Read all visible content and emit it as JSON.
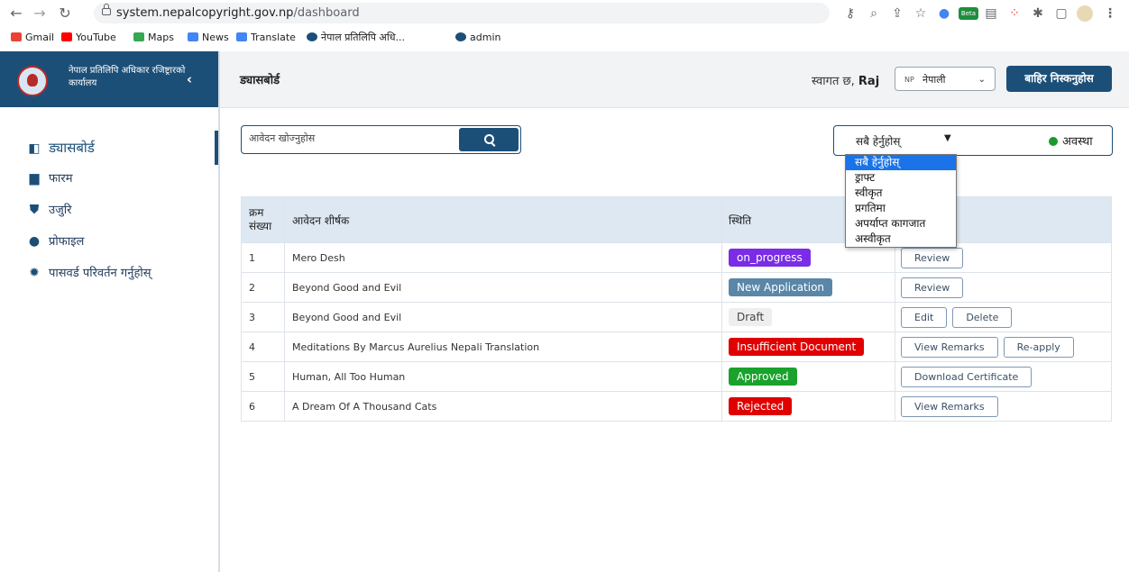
{
  "browser": {
    "url_host": "system.nepalcopyright.gov.np",
    "url_path": "/dashboard",
    "beta_badge": "Beta",
    "bookmarks": [
      {
        "label": "Gmail",
        "icon": "gmail-icon",
        "color": "#ea4335"
      },
      {
        "label": "YouTube",
        "icon": "youtube-icon",
        "color": "#ff0000"
      },
      {
        "label": "Maps",
        "icon": "maps-icon",
        "color": "#34a853"
      },
      {
        "label": "News",
        "icon": "news-icon",
        "color": "#4285f4"
      },
      {
        "label": "Translate",
        "icon": "translate-icon",
        "color": "#4285f4"
      },
      {
        "label": "नेपाल प्रतिलिपि अधि...",
        "icon": "nepal-emblem-icon",
        "color": "#1c4f78"
      },
      {
        "label": "admin",
        "icon": "nepal-emblem-icon",
        "color": "#1c4f78"
      }
    ]
  },
  "sidebar": {
    "office_name": "नेपाल प्रतिलिपि अधिकार रजिष्ट्रारको कार्यालय",
    "items": [
      {
        "label": "ड्यासबोर्ड",
        "icon": "dashboard-icon",
        "active": true
      },
      {
        "label": "फारम",
        "icon": "file-icon",
        "active": false
      },
      {
        "label": "उजुरि",
        "icon": "shield-icon",
        "active": false
      },
      {
        "label": "प्रोफाइल",
        "icon": "user-icon",
        "active": false
      },
      {
        "label": "पासवर्ड परिवर्तन गर्नुहोस्",
        "icon": "gear-icon",
        "active": false
      }
    ]
  },
  "header": {
    "title": "ड्यासबोर्ड",
    "welcome": "स्वागत छ,",
    "user": "Raj",
    "language_code": "NP",
    "language": "नेपाली",
    "logout": "बाहिर निस्कनुहोस"
  },
  "search": {
    "placeholder": "आवेदन खोज्नुहोस"
  },
  "filter": {
    "selected": "सबै हेर्नुहोस्",
    "status_label": "अवस्था",
    "options": [
      "सबै हेर्नुहोस्",
      "ड्राफ्ट",
      "स्वीकृत",
      "प्रगतिमा",
      "अपर्याप्त कागजात",
      "अस्वीकृत"
    ]
  },
  "table": {
    "headers": {
      "no": "क्रम संख्या",
      "title": "आवेदन शीर्षक",
      "status": "स्थिति",
      "actions": ""
    },
    "rows": [
      {
        "no": "1",
        "title": "Mero Desh",
        "status": "on_progress",
        "status_color": "#7b2ce6",
        "actions": [
          "Review"
        ]
      },
      {
        "no": "2",
        "title": "Beyond Good and Evil",
        "status": "New Application",
        "status_color": "#5a87a8",
        "actions": [
          "Review"
        ]
      },
      {
        "no": "3",
        "title": "Beyond Good and Evil",
        "status": "Draft",
        "status_color": "#eeeeee",
        "status_text_color": "#444444",
        "actions": [
          "Edit",
          "Delete"
        ]
      },
      {
        "no": "4",
        "title": "Meditations By Marcus Aurelius Nepali Translation",
        "status": "Insufficient Document",
        "status_color": "#e00000",
        "actions": [
          "View Remarks",
          "Re-apply"
        ]
      },
      {
        "no": "5",
        "title": "Human, All Too Human",
        "status": "Approved",
        "status_color": "#19a22c",
        "actions": [
          "Download Certificate"
        ]
      },
      {
        "no": "6",
        "title": "A Dream Of A Thousand Cats",
        "status": "Rejected",
        "status_color": "#e00000",
        "actions": [
          "View Remarks"
        ]
      }
    ]
  },
  "colors": {
    "brand": "#1c4f78",
    "header_bg": "#f1f3f5",
    "table_head_bg": "#dde8f2",
    "dropdown_highlight": "#1a73e8"
  }
}
